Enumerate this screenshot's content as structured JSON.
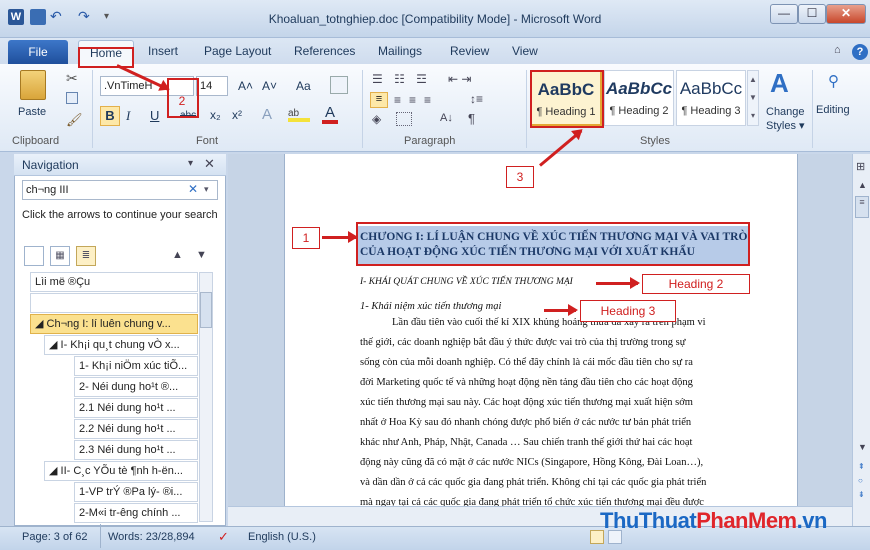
{
  "window": {
    "title": "Khoaluan_totnghiep.doc [Compatibility Mode] - Microsoft Word",
    "app_icon": "W",
    "min_icon": "minimize-icon",
    "max_icon": "maximize-icon",
    "close_icon": "close-icon"
  },
  "tabs": [
    "File",
    "Home",
    "Insert",
    "Page Layout",
    "References",
    "Mailings",
    "Review",
    "View"
  ],
  "ribbon": {
    "clipboard": {
      "paste": "Paste",
      "label": "Clipboard"
    },
    "font": {
      "name": ".VnTimeH",
      "size": "14",
      "label": "Font",
      "bold": "B",
      "italic": "I",
      "underline": "U",
      "strike": "abc",
      "subscript": "x₂",
      "superscript": "x²",
      "grow": "A˄",
      "shrink": "A˅",
      "case": "Aa"
    },
    "paragraph": {
      "label": "Paragraph",
      "pilcrow": "¶"
    },
    "styles": {
      "label": "Styles",
      "items": [
        {
          "sample": "AaBbC",
          "name": "¶ Heading 1"
        },
        {
          "sample": "AaBbCc",
          "name": "¶ Heading 2"
        },
        {
          "sample": "AaBbCc",
          "name": "¶ Heading 3"
        }
      ],
      "change": "Change",
      "change2": "Styles ▾"
    },
    "editing": "Editing"
  },
  "nav": {
    "title": "Navigation",
    "search_value": "ch¬ng III",
    "hint": "Click the arrows to continue your search",
    "items": [
      "Lìi më ®Çu",
      "",
      "◢ Ch¬ng I: lí luên chung v...",
      "◢ I- Kh¡i qu¸t chung vÒ x...",
      "1- Kh¡i niÖm xúc tiÕ...",
      "2- Néi dung ho¹t ®...",
      "2.1 Néi dung ho¹t ...",
      "2.2 Néi dung ho¹t ...",
      "2.3 Néi dung ho¹t ...",
      "◢ II- C¸c YÕu tè ¶nh h-ën...",
      "1-VP trÝ ®Pa lý- ®i...",
      "2-M«i tr-êng chính ..."
    ]
  },
  "document": {
    "heading1": "CHƯONG I: LÍ LUẬN CHUNG VỀ XÚC TIẾN THƯƠNG MẠI VÀ VAI TRÒ CỦA HOẠT ĐỘNG XÚC TIẾN THƯƠNG MẠI VỚI XUẤT KHẨU",
    "heading2": "I- KHÁI QUÁT CHUNG VỀ XÚC TIẾN THƯƠNG MẠI",
    "heading3": "1- Khái niệm xúc tiến thương mại",
    "lines": [
      "Lần đầu tiên vào cuối thế kỉ XIX khủng hoảng thừa đã xảy ra trên phạm vi",
      "thế giới, các doanh nghiệp bắt đầu ý thức được vai trò của thị trường trong sự",
      "sống còn của mỗi doanh nghiệp. Có thể đây chính là cái mốc đầu tiên cho sự ra",
      "đời Marketing quốc tế và những hoạt động nền tảng đầu tiên cho các hoạt động",
      "xúc tiến thương mại sau này. Các hoạt động xúc tiến thương mại xuất hiện sớm",
      "nhất ở Hoa Kỳ sau đó nhanh chóng được phổ biến ở các nước tư bản phát triển",
      "khác như Anh, Pháp, Nhật, Canada … Sau chiến tranh thế giới thứ hai các hoạt",
      "động này cũng đã có mặt ở các nước NICs (Singapore, Hồng Kông, Đài Loan…),",
      "và dần dần ở cả các quốc gia đang phát triển. Không chỉ tại các quốc gia phát triển",
      "mà ngay tại cả các quốc gia đang phát triển tổ chức xúc tiến thương mại đều được"
    ]
  },
  "annotations": {
    "n1": "1",
    "n2": "2",
    "n3": "3",
    "h2": "Heading 2",
    "h3": "Heading 3"
  },
  "status": {
    "page": "Page: 3 of 62",
    "words": "Words: 23/28,894",
    "language": "English (U.S.)"
  },
  "watermark": {
    "part1": "ThuThuat",
    "part2": "PhanMem",
    "part3": ".vn"
  },
  "colors": {
    "accent": "#2b5797",
    "annotation": "#d02020",
    "selection": "#b7cbe8"
  }
}
